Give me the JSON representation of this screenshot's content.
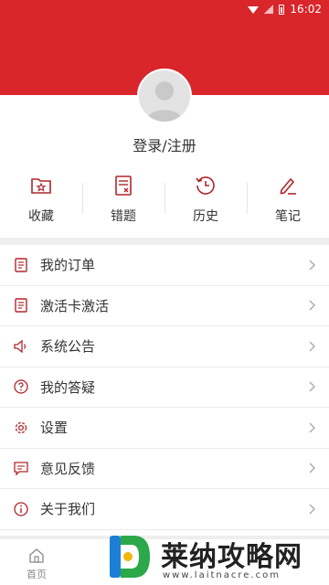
{
  "status_bar": {
    "time": "16:02"
  },
  "profile": {
    "login_label": "登录/注册"
  },
  "quick_actions": [
    {
      "label": "收藏",
      "icon": "folder-star-icon"
    },
    {
      "label": "错题",
      "icon": "wrong-question-icon"
    },
    {
      "label": "历史",
      "icon": "history-clock-icon"
    },
    {
      "label": "笔记",
      "icon": "pen-note-icon"
    }
  ],
  "menu": [
    {
      "label": "我的订单",
      "icon": "order-doc-icon"
    },
    {
      "label": "激活卡激活",
      "icon": "activation-card-icon"
    },
    {
      "label": "系统公告",
      "icon": "speaker-icon"
    },
    {
      "label": "我的答疑",
      "icon": "question-circle-icon"
    },
    {
      "label": "设置",
      "icon": "gear-icon"
    },
    {
      "label": "意见反馈",
      "icon": "feedback-chat-icon"
    },
    {
      "label": "关于我们",
      "icon": "info-circle-icon"
    }
  ],
  "tabbar": {
    "home_label": "首页"
  },
  "watermark": {
    "title": "莱纳攻略网",
    "url": "www.laitnacre.com"
  },
  "colors": {
    "brand": "#d9262b",
    "icon": "#b0262b",
    "text": "#333333"
  }
}
